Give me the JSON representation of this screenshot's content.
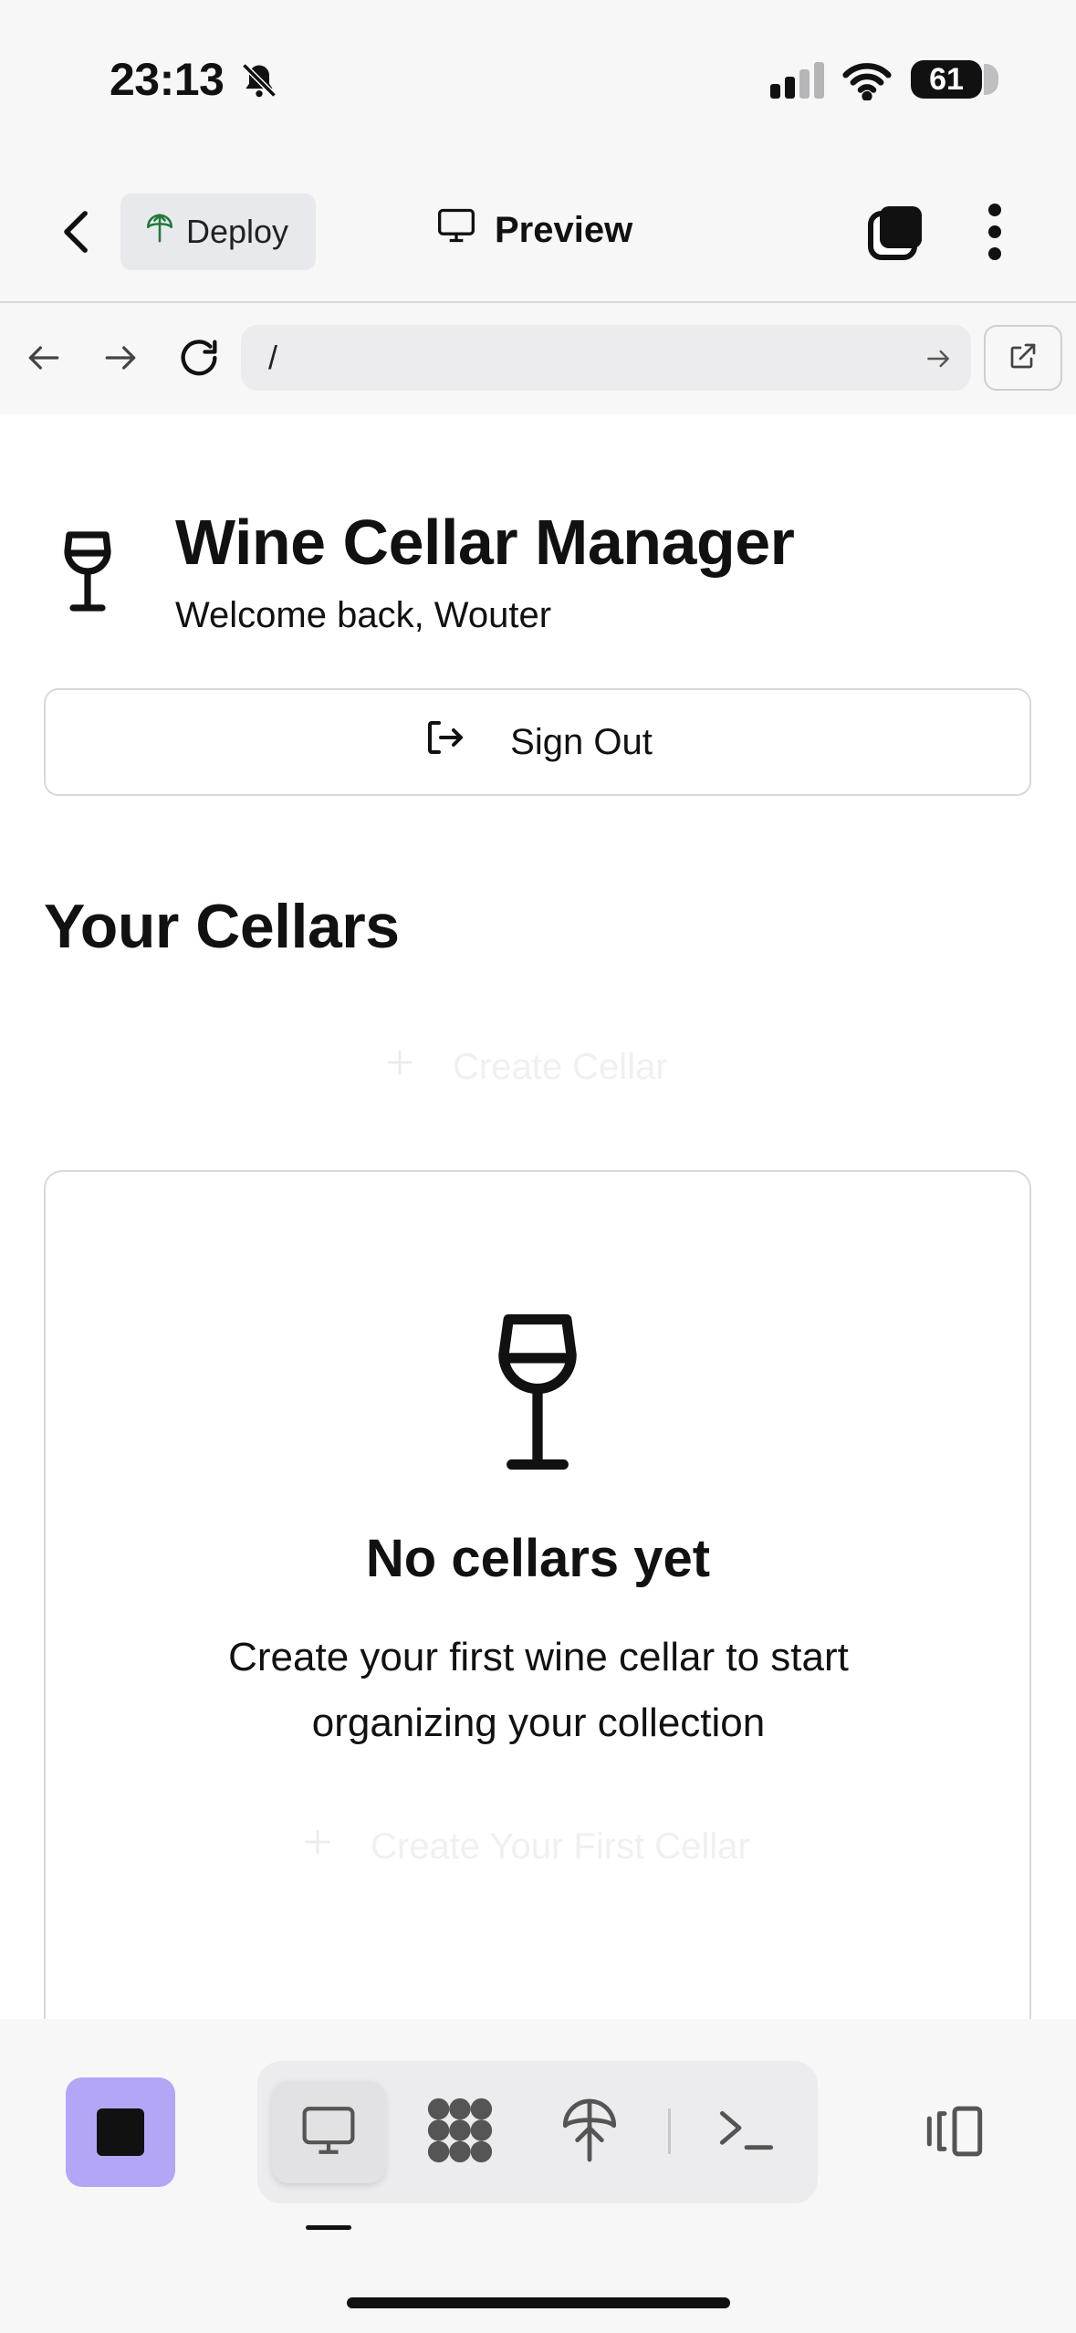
{
  "status_bar": {
    "time": "23:13",
    "battery": "61"
  },
  "header": {
    "deploy_label": "Deploy",
    "preview_label": "Preview"
  },
  "browser": {
    "url": "/"
  },
  "app": {
    "title": "Wine Cellar Manager",
    "welcome": "Welcome back, Wouter",
    "sign_out_label": "Sign Out",
    "section_title": "Your Cellars",
    "create_cellar_label": "Create Cellar",
    "empty_title": "No cellars yet",
    "empty_text": "Create your first wine cellar to start organizing your collection",
    "create_first_label": "Create Your First Cellar"
  },
  "toolbar": {
    "tools": [
      "desktop-preview",
      "agents",
      "deploy",
      "terminal"
    ],
    "accent_color": "#b4a6f7"
  }
}
